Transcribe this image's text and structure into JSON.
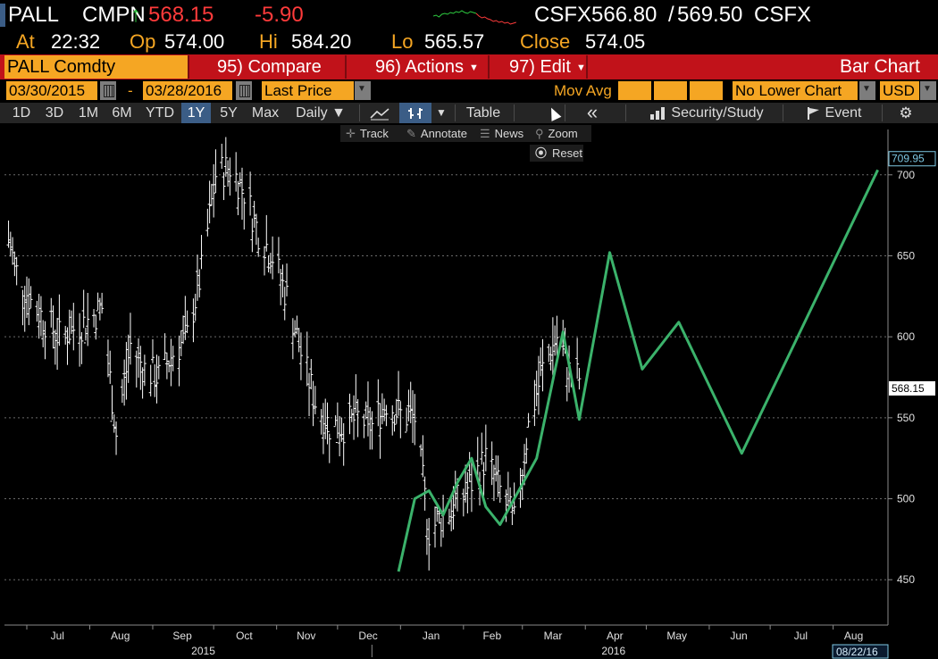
{
  "header": {
    "ticker": "PALL",
    "source": "CMPN",
    "arrow": "↑",
    "last": "568.15",
    "change": "-5.90",
    "bid_src": "CSFX",
    "bid": "566.80",
    "slash": "/",
    "ask": "569.50",
    "ask_src": "CSFX",
    "at_label": "At",
    "at_time": "22:32",
    "op_label": "Op",
    "op": "574.00",
    "hi_label": "Hi",
    "hi": "584.20",
    "lo_label": "Lo",
    "lo": "565.57",
    "close_label": "Close",
    "close": "574.05"
  },
  "funcbar": {
    "security": "PALL Comdty",
    "compare": "95) Compare",
    "actions": "96) Actions",
    "edit": "97) Edit",
    "title": "Bar Chart"
  },
  "daterow": {
    "start_date": "03/30/2015",
    "dash": "-",
    "end_date": "03/28/2016",
    "field": "Last Price",
    "mov_avg": "Mov Avg",
    "lower_chart": "No Lower Chart",
    "currency": "USD"
  },
  "toolbar": {
    "periods": [
      "1D",
      "3D",
      "1M",
      "6M",
      "YTD",
      "1Y",
      "5Y",
      "Max"
    ],
    "selected_period": "1Y",
    "frequency": "Daily ▼",
    "table": "Table",
    "collapse": "«",
    "security_study": "Security/Study",
    "event": "Event"
  },
  "chart_menu": {
    "track": "Track",
    "annotate": "Annotate",
    "news": "News",
    "zoom": "Zoom",
    "reset": "Reset"
  },
  "colors": {
    "amber": "#f5a623",
    "function_bar": "#c1121a",
    "positive": "#2ecc40",
    "negative": "#ff3b3b",
    "forecast_line": "#3bb26b",
    "price_bars": "#ffffff"
  },
  "chart_data": {
    "type": "line",
    "ylim": [
      422,
      728
    ],
    "y_ticks": [
      450,
      500,
      550,
      600,
      650,
      700
    ],
    "x_ticks": [
      "Jul",
      "Aug",
      "Sep",
      "Oct",
      "Nov",
      "Dec",
      "Jan",
      "Feb",
      "Mar",
      "Apr",
      "May",
      "Jun",
      "Jul",
      "Aug"
    ],
    "x_years": [
      "2015",
      "2016"
    ],
    "price_tags": {
      "high_tag": "709.95",
      "last_tag": "568.15",
      "end_date_tag": "08/22/16"
    },
    "price_series": {
      "x": [
        "2015-06-22",
        "2015-06-26",
        "2015-07-03",
        "2015-07-10",
        "2015-07-17",
        "2015-07-24",
        "2015-07-31",
        "2015-08-07",
        "2015-08-14",
        "2015-08-21",
        "2015-08-28",
        "2015-09-04",
        "2015-09-11",
        "2015-09-18",
        "2015-09-25",
        "2015-10-02",
        "2015-10-09",
        "2015-10-16",
        "2015-10-23",
        "2015-10-30",
        "2015-11-06",
        "2015-11-13",
        "2015-11-20",
        "2015-11-27",
        "2015-12-04",
        "2015-12-11",
        "2015-12-18",
        "2015-12-25",
        "2016-01-01",
        "2016-01-08",
        "2016-01-15",
        "2016-01-22",
        "2016-01-29",
        "2016-02-05",
        "2016-02-12",
        "2016-02-19",
        "2016-02-26",
        "2016-03-04",
        "2016-03-11",
        "2016-03-18",
        "2016-03-25"
      ],
      "values": [
        660,
        640,
        622,
        610,
        600,
        605,
        610,
        618,
        540,
        595,
        580,
        575,
        590,
        600,
        640,
        700,
        705,
        690,
        665,
        650,
        625,
        590,
        560,
        545,
        545,
        550,
        545,
        560,
        552,
        550,
        480,
        490,
        498,
        510,
        525,
        505,
        485,
        545,
        580,
        600,
        575
      ]
    },
    "series": [
      {
        "x": [
          "2015-12-31",
          "2016-01-08",
          "2016-01-15",
          "2016-01-22",
          "2016-01-29",
          "2016-02-05",
          "2016-02-12",
          "2016-02-19",
          "2016-03-08",
          "2016-03-21",
          "2016-03-29",
          "2016-04-13",
          "2016-04-29",
          "2016-05-17",
          "2016-06-17",
          "2016-08-23"
        ],
        "values": [
          455,
          500,
          505,
          490,
          510,
          525,
          495,
          484,
          525,
          603,
          549,
          652,
          580,
          609,
          528,
          703
        ]
      }
    ]
  }
}
